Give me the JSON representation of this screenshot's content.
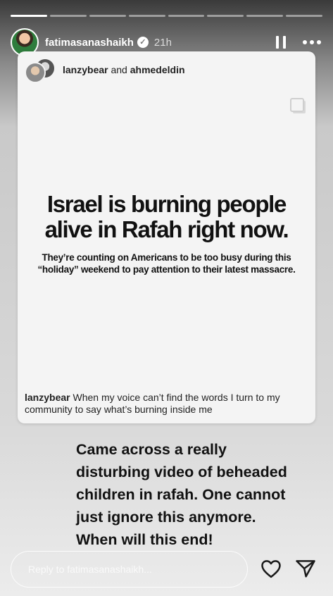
{
  "progress": {
    "total_segments": 8,
    "active_index": 0
  },
  "header": {
    "username": "fatimasanashaikh",
    "verified_icon": "verified-badge-icon",
    "time": "21h",
    "pause_icon": "pause-icon",
    "more_icon": "more-options-icon"
  },
  "post": {
    "collab_user_1": "lanzybear",
    "collab_and": "and",
    "collab_user_2": "ahmedeldin",
    "headline": "Israel is burning people\nalive in Rafah right now.",
    "subline": "They’re counting on Americans to be too busy during this\n“holiday” weekend to pay attention to their latest massacre.",
    "caption_user": "lanzybear",
    "caption_text": "When my voice can’t find the words I turn to my community to say what’s burning inside me"
  },
  "story_text": "Came across a really disturbing video of beheaded children in rafah. One cannot just ignore this anymore. When will this end!",
  "reply": {
    "placeholder": "Reply to fatimasanashaikh...",
    "value": ""
  },
  "icons": {
    "like": "heart-icon",
    "share": "send-icon"
  }
}
